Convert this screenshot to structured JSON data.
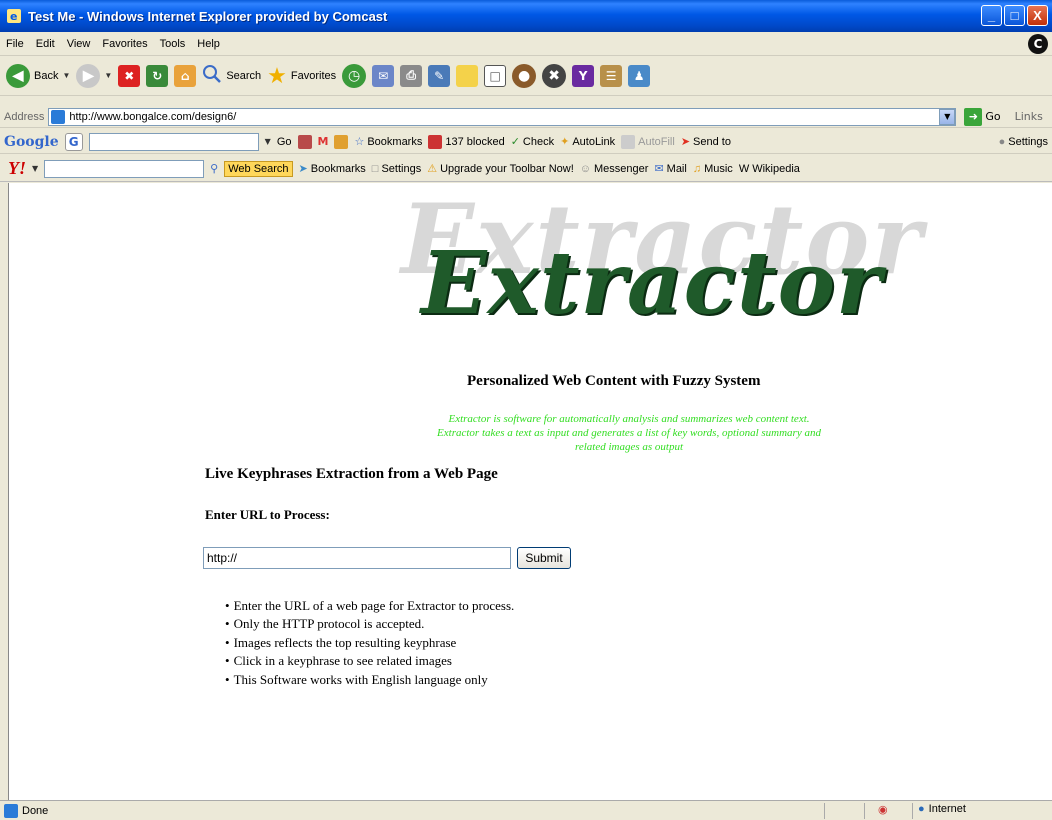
{
  "window": {
    "title": "Test Me - Windows Internet Explorer provided by Comcast",
    "minimize_glyph": "_",
    "maximize_glyph": "□",
    "close_glyph": "X"
  },
  "menu": {
    "items": [
      "File",
      "Edit",
      "View",
      "Favorites",
      "Tools",
      "Help"
    ],
    "comcast_glyph": "C"
  },
  "toolbar": {
    "back_label": "Back",
    "search_label": "Search",
    "favorites_label": "Favorites"
  },
  "address": {
    "label": "Address",
    "url": "http://www.bongalce.com/design6/",
    "go_label": "Go",
    "links_label": "Links"
  },
  "google_toolbar": {
    "logo": "Google",
    "go_label": "Go",
    "bookmarks_label": "Bookmarks",
    "blocked_label": "137 blocked",
    "check_label": "Check",
    "autolink_label": "AutoLink",
    "autofill_label": "AutoFill",
    "sendto_label": "Send to",
    "settings_label": "Settings"
  },
  "yahoo_toolbar": {
    "logo": "Y!",
    "websearch_label": "Web Search",
    "bookmarks_label": "Bookmarks",
    "settings_label": "Settings",
    "upgrade_label": "Upgrade your Toolbar Now!",
    "messenger_label": "Messenger",
    "mail_label": "Mail",
    "music_label": "Music",
    "wikipedia_label": "Wikipedia"
  },
  "page": {
    "logo_ghost": "Extractor",
    "logo_text": "Extractor",
    "subtitle": "Personalized Web Content with Fuzzy System",
    "description_line1": "Extractor is software for automatically analysis and summarizes web content text.",
    "description_line2": "Extractor takes a text as input and generates a list of key words, optional summary and",
    "description_line3": "related images as output",
    "heading": "Live Keyphrases Extraction from a Web Page",
    "url_label": "Enter URL to Process:",
    "url_value": "http://",
    "submit_label": "Submit",
    "tips": [
      "Enter the URL of a web page for Extractor to process.",
      "Only the HTTP protocol is accepted.",
      "Images reflects the top resulting keyphrase",
      "Click in a keyphrase to see related images",
      "This Software works with English language only"
    ]
  },
  "status": {
    "text": "Done",
    "zone": "Internet"
  },
  "colors": {
    "titlebar": "#0058e6",
    "description_green": "#33dd22",
    "logo_green": "#1f5a2a"
  }
}
